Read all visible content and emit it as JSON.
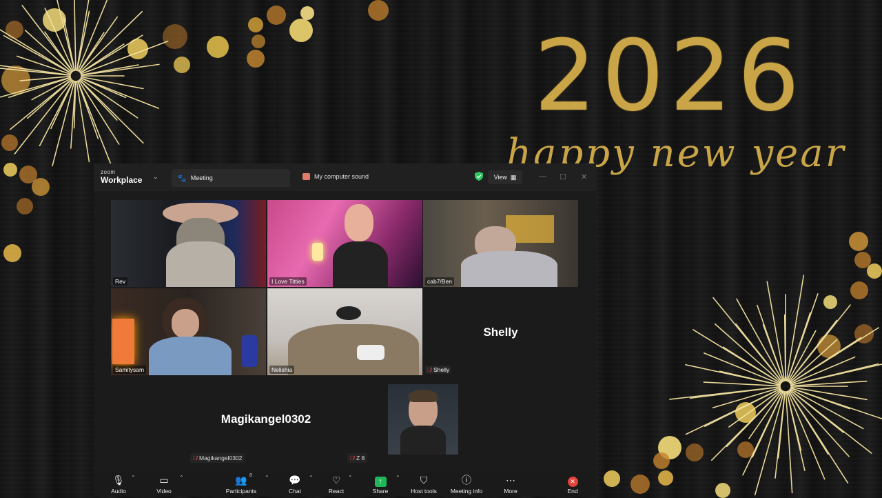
{
  "background": {
    "year": "2026",
    "greeting": "happy new year",
    "gold_color": "#c9a548"
  },
  "window": {
    "brand_small": "zoom",
    "brand_big": "Workplace",
    "tab_meeting": "Meeting",
    "tab_sound": "My computer sound",
    "view_label": "View",
    "minimize_glyph": "—",
    "maximize_glyph": "☐",
    "close_glyph": "✕"
  },
  "participants": [
    {
      "name": "Rev",
      "active_speaker": true
    },
    {
      "name": "I Love Titties"
    },
    {
      "name": "cab7/Ben"
    },
    {
      "name": "Samitysam"
    },
    {
      "name": "Nelishia"
    },
    {
      "name": "Shelly",
      "video_off": true,
      "muted": true
    },
    {
      "name": "Magikangel0302",
      "video_off": true,
      "muted": true
    },
    {
      "name": "Z 8",
      "muted": true
    }
  ],
  "toolbar": {
    "audio": "Audio",
    "video": "Video",
    "participants": "Participants",
    "participants_count": "8",
    "chat": "Chat",
    "react": "React",
    "share": "Share",
    "host_tools": "Host tools",
    "meeting_info": "Meeting info",
    "more": "More",
    "end": "End"
  },
  "colors": {
    "active_speaker": "#2ee08a",
    "share_green": "#1fb75a",
    "end_red": "#e0443b",
    "muted_red": "#e0443b"
  }
}
